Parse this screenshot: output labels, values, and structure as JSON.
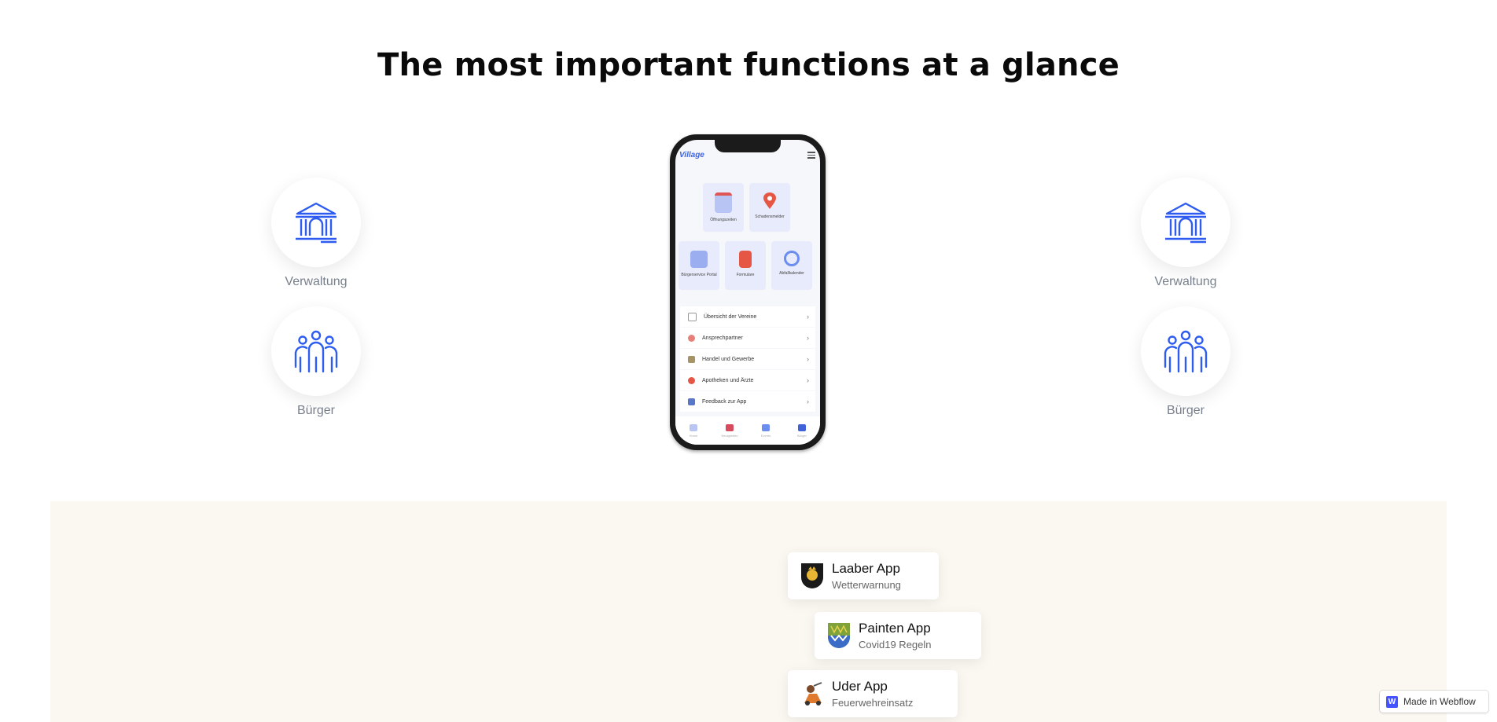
{
  "headline": "The most important functions at a glance",
  "features_left": [
    {
      "label": "Verwaltung",
      "icon": "government-building-icon"
    },
    {
      "label": "Bürger",
      "icon": "citizens-group-icon"
    }
  ],
  "features_right": [
    {
      "label": "Verwaltung",
      "icon": "government-building-icon"
    },
    {
      "label": "Bürger",
      "icon": "citizens-group-icon"
    }
  ],
  "phone": {
    "brand": "Village",
    "tiles_top": [
      "Öffnungszeiten",
      "Schadensmelder"
    ],
    "tiles_mid": [
      "Bürgerservice Portal",
      "Formulare",
      "Abfallkalender"
    ],
    "list": [
      "Übersicht der Vereine",
      "Ansprechpartner",
      "Handel und Gewerbe",
      "Apotheken und Ärzte",
      "Feedback zur App"
    ],
    "tabs": [
      "Home",
      "Neuigkeiten",
      "Events",
      "Bürger"
    ]
  },
  "apps": [
    {
      "name": "Laaber App",
      "subtitle": "Wetterwarnung",
      "icon": "laaber-crest-icon"
    },
    {
      "name": "Painten App",
      "subtitle": "Covid19 Regeln",
      "icon": "painten-crest-icon"
    },
    {
      "name": "Uder App",
      "subtitle": "Feuerwehreinsatz",
      "icon": "uder-crest-icon"
    }
  ],
  "badge": {
    "letter": "W",
    "label": "Made in Webflow"
  },
  "colors": {
    "accent": "#2f5cf0",
    "beige": "#fbf7f1",
    "label": "#77808c"
  }
}
